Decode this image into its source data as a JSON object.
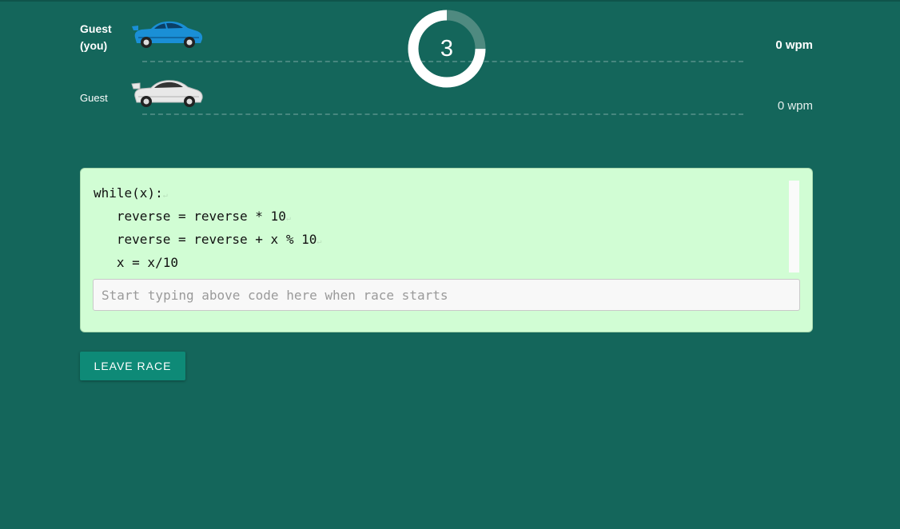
{
  "race": {
    "countdown": "3",
    "countdown_progress": 0.25,
    "players": [
      {
        "name": "Guest (you)",
        "wpm": "0 wpm",
        "car_color": "#1a8fd6"
      },
      {
        "name": "Guest",
        "wpm": "0 wpm",
        "car_color": "#e8e8e8"
      }
    ]
  },
  "code": {
    "lines": [
      "while(x):",
      "   reverse = reverse * 10",
      "   reverse = reverse + x % 10",
      "   x = x/10"
    ]
  },
  "input": {
    "placeholder": "Start typing above code here when race starts"
  },
  "actions": {
    "leave_label": "LEAVE RACE"
  },
  "colors": {
    "background": "#14665b",
    "panel": "#d1fdd4",
    "button": "#0e8a77"
  }
}
